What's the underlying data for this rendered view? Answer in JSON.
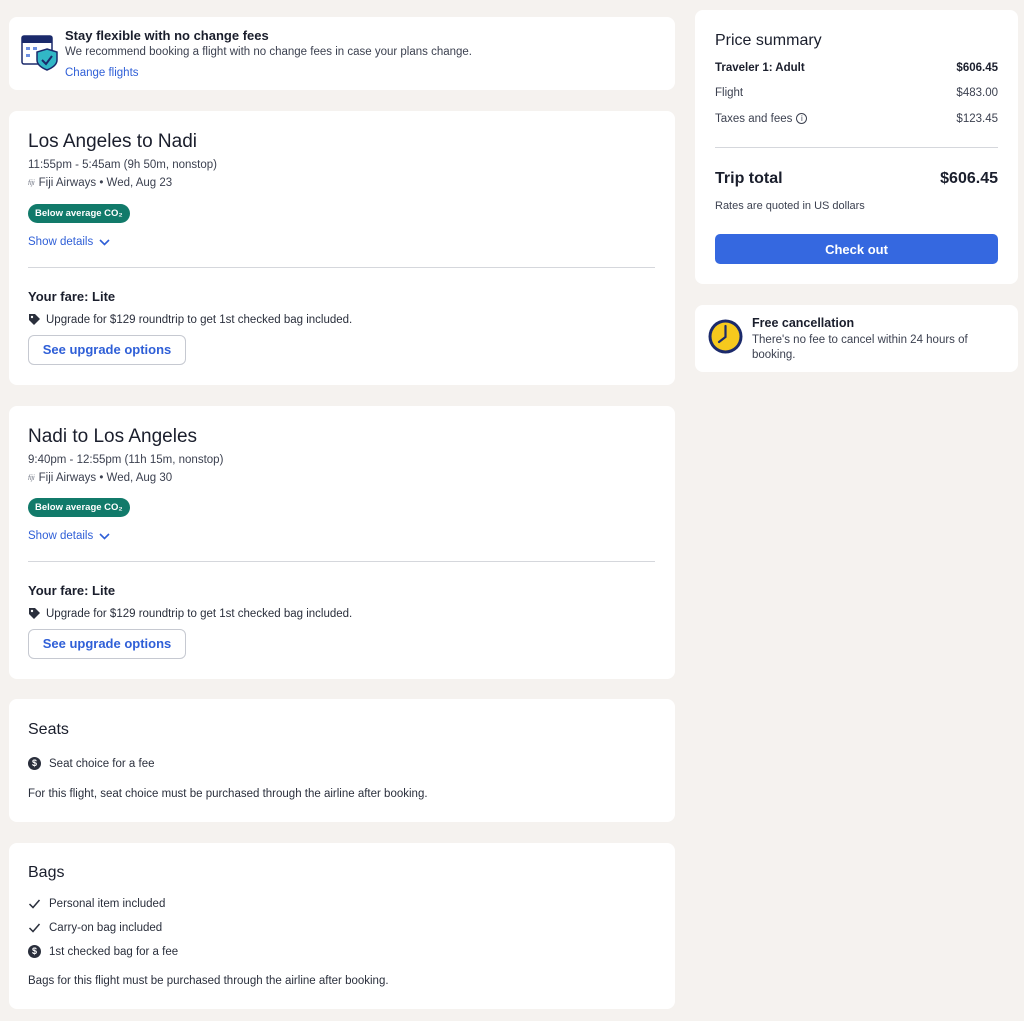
{
  "banner": {
    "title": "Stay flexible with no change fees",
    "description": "We recommend booking a flight with no change fees in case your plans change.",
    "link": "Change flights"
  },
  "flights": [
    {
      "route": "Los Angeles to Nadi",
      "times": "11:55pm - 5:45am (9h 50m, nonstop)",
      "airline_logo": "fiji",
      "airline": "Fiji Airways • Wed, Aug 23",
      "badge": "Below average CO₂",
      "details": "Show details",
      "fare": "Your fare: Lite",
      "upgrade": "Upgrade for $129 roundtrip to get 1st checked bag included.",
      "upgrade_button": "See upgrade options"
    },
    {
      "route": "Nadi to Los Angeles",
      "times": "9:40pm - 12:55pm (11h 15m, nonstop)",
      "airline_logo": "fiji",
      "airline": "Fiji Airways • Wed, Aug 30",
      "badge": "Below average CO₂",
      "details": "Show details",
      "fare": "Your fare: Lite",
      "upgrade": "Upgrade for $129 roundtrip to get 1st checked bag included.",
      "upgrade_button": "See upgrade options"
    }
  ],
  "seats": {
    "title": "Seats",
    "item": "Seat choice for a fee",
    "note": "For this flight, seat choice must be purchased through the airline after booking."
  },
  "bags": {
    "title": "Bags",
    "items": [
      "Personal item included",
      "Carry-on bag included",
      "1st checked bag for a fee"
    ],
    "note": "Bags for this flight must be purchased through the airline after booking."
  },
  "price_summary": {
    "title": "Price summary",
    "traveler_label": "Traveler 1: Adult",
    "traveler_price": "$606.45",
    "flight_label": "Flight",
    "flight_price": "$483.00",
    "taxes_label": "Taxes and fees",
    "taxes_price": "$123.45",
    "total_label": "Trip total",
    "total_price": "$606.45",
    "rates_note": "Rates are quoted in US dollars",
    "checkout_label": "Check out"
  },
  "cancellation": {
    "title": "Free cancellation",
    "description": "There's no fee to cancel within 24 hours of booking."
  },
  "colors": {
    "accent": "#3568e0",
    "link": "#2f5fd7",
    "badge": "#117a6a",
    "background": "#f5f2ef"
  },
  "icons": [
    "calendar-shield-icon",
    "chevron-down-icon",
    "tag-icon",
    "dollar-icon",
    "check-icon",
    "info-icon",
    "clock-icon"
  ]
}
